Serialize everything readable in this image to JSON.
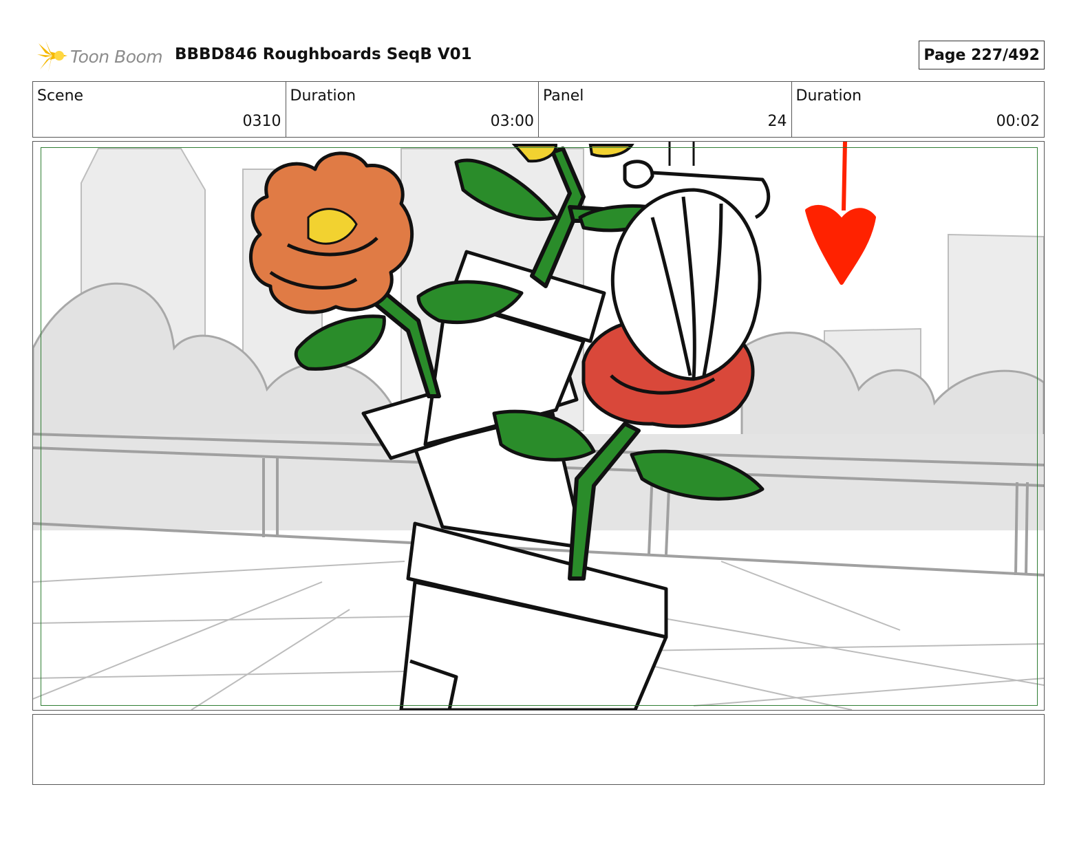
{
  "header": {
    "logo_text": "Toon Boom",
    "project_title": "BBBD846 Roughboards SeqB V01",
    "page_label": "Page 227/492"
  },
  "info": {
    "scene_label": "Scene",
    "scene_value": "0310",
    "scene_duration_label": "Duration",
    "scene_duration_value": "03:00",
    "panel_label": "Panel",
    "panel_value": "24",
    "panel_duration_label": "Duration",
    "panel_duration_value": "00:02"
  },
  "panel": {
    "image": "storyboard-sketch",
    "colors": {
      "safe_frame": "#2e7d32",
      "leaf_green": "#2a8c2a",
      "orange_flower": "#e07b45",
      "red_rose": "#d9483a",
      "arrow_red": "#ff2200",
      "yellow": "#f2d230",
      "background_gray": "#e6e6e6"
    }
  },
  "notes": {
    "text": ""
  }
}
